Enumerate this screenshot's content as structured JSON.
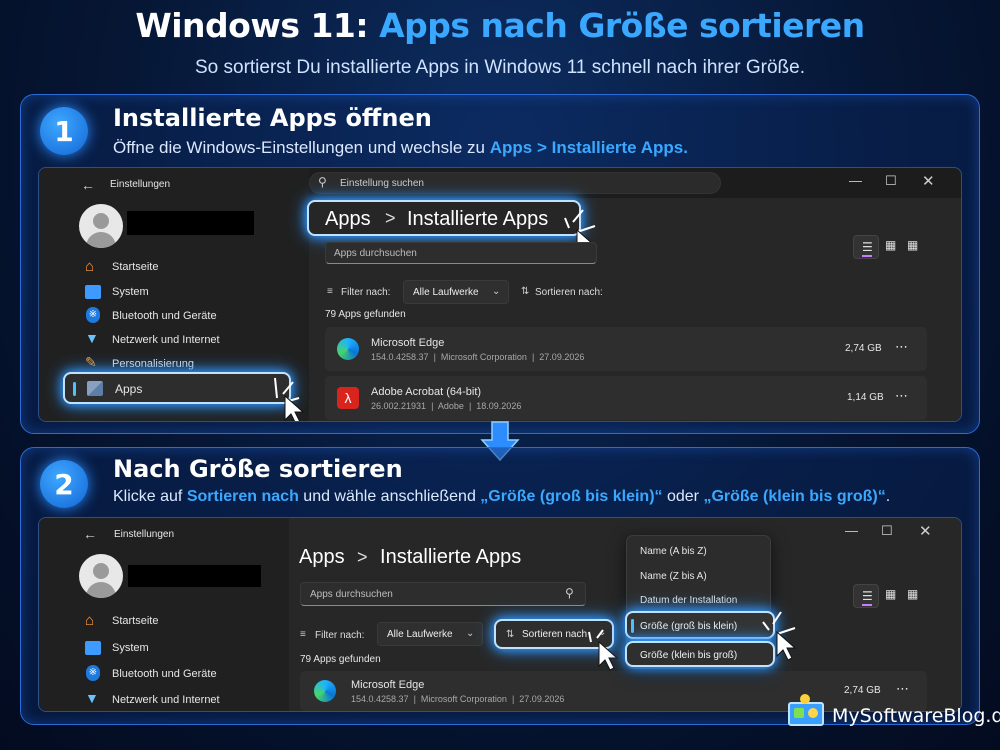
{
  "header": {
    "title_prefix": "Windows 11:",
    "title_highlight": "Apps nach Größe sortieren",
    "subtitle": "So sortierst Du installierte Apps in Windows 11 schnell nach ihrer Größe."
  },
  "step1": {
    "number": "1",
    "title": "Installierte Apps öffnen",
    "desc_prefix": "Öffne die Windows-Einstellungen und wechsle zu ",
    "desc_highlight": "Apps > Installierte Apps.",
    "window": {
      "title": "Einstellungen",
      "search_placeholder": "Einstellung suchen",
      "nav": [
        {
          "label": "Startseite",
          "icon": "home-icon"
        },
        {
          "label": "System",
          "icon": "monitor-icon"
        },
        {
          "label": "Bluetooth und Geräte",
          "icon": "bluetooth-icon"
        },
        {
          "label": "Netzwerk und Internet",
          "icon": "wifi-icon"
        },
        {
          "label": "Personalisierung",
          "icon": "brush-icon"
        },
        {
          "label": "Apps",
          "icon": "apps-icon"
        }
      ],
      "breadcrumb_root": "Apps",
      "breadcrumb_sep": ">",
      "breadcrumb_page": "Installierte Apps",
      "apps_search_placeholder": "Apps durchsuchen",
      "filter_label": "Filter nach:",
      "filter_value": "Alle Laufwerke",
      "sort_label": "Sortieren nach:",
      "count": "79 Apps gefunden",
      "apps": [
        {
          "name": "Microsoft Edge",
          "version": "154.0.4258.37",
          "publisher": "Microsoft Corporation",
          "date": "27.09.2026",
          "size": "2,74 GB"
        },
        {
          "name": "Adobe Acrobat (64-bit)",
          "version": "26.002.21931",
          "publisher": "Adobe",
          "date": "18.09.2026",
          "size": "1,14 GB"
        }
      ]
    }
  },
  "step2": {
    "number": "2",
    "title": "Nach Größe sortieren",
    "desc_p1": "Klicke auf ",
    "desc_h1": "Sortieren nach",
    "desc_p2": " und wähle anschließend ",
    "desc_h2": "„Größe (groß bis klein)“",
    "desc_p3": " oder ",
    "desc_h3": "„Größe (klein bis groß)“",
    "desc_p4": ".",
    "window": {
      "title": "Einstellungen",
      "nav": [
        {
          "label": "Startseite",
          "icon": "home-icon"
        },
        {
          "label": "System",
          "icon": "monitor-icon"
        },
        {
          "label": "Bluetooth und Geräte",
          "icon": "bluetooth-icon"
        },
        {
          "label": "Netzwerk und Internet",
          "icon": "wifi-icon"
        }
      ],
      "breadcrumb_root": "Apps",
      "breadcrumb_sep": ">",
      "breadcrumb_page": "Installierte Apps",
      "apps_search_placeholder": "Apps durchsuchen",
      "filter_label": "Filter nach:",
      "filter_value": "Alle Laufwerke",
      "sort_label": "Sortieren nach",
      "count": "79 Apps gefunden",
      "sort_menu": [
        "Name (A bis Z)",
        "Name (Z bis A)",
        "Datum der Installation",
        "Größe (groß bis klein)",
        "Größe (klein bis groß)"
      ],
      "apps": [
        {
          "name": "Microsoft Edge",
          "version": "154.0.4258.37",
          "publisher": "Microsoft Corporation",
          "date": "27.09.2026",
          "size": "2,74 GB"
        }
      ]
    }
  },
  "watermark": "MySoftwareBlog.de",
  "colors": {
    "accent": "#3ba8ff",
    "glow": "#2f95ff",
    "bg": "#061634"
  }
}
